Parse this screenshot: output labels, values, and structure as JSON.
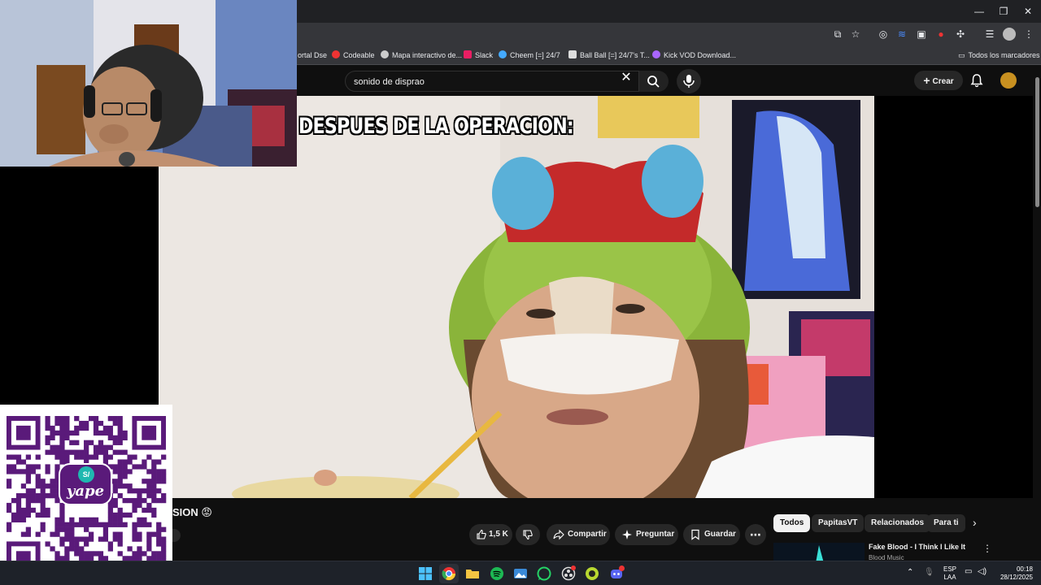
{
  "browser": {
    "bookmarks": [
      {
        "label": "ortal Dse",
        "color": "#3a5"
      },
      {
        "label": "Codeable",
        "color": "#e33"
      },
      {
        "label": "Mapa interactivo de...",
        "color": "#ddd"
      },
      {
        "label": "Slack",
        "color": "#e91e63"
      },
      {
        "label": "Cheem [=] 24/7",
        "color": "#4af"
      },
      {
        "label": "Ball Ball [=] 24/7's T...",
        "color": "#ddd"
      },
      {
        "label": "Kick VOD Download...",
        "color": "#a6f"
      }
    ],
    "all_bookmarks_label": "Todos los marcadores"
  },
  "youtube": {
    "search_value": "sonido de disprao",
    "create_label": "Crear",
    "video_caption": "DESPUES DE LA OPERACION:",
    "video_title_fragment": "SION 😡",
    "actions": {
      "like_count": "1,5 K",
      "share_label": "Compartir",
      "ask_label": "Preguntar",
      "save_label": "Guardar"
    },
    "chips": [
      "Todos",
      "PapitasVT",
      "Relacionados",
      "Para ti"
    ],
    "suggested": {
      "title": "Fake Blood - I Think I Like It",
      "channel": "Blood Music"
    }
  },
  "overlay": {
    "qr_brand": "yape"
  },
  "taskbar": {
    "language_line1": "ESP",
    "language_line2": "LAA",
    "time": "00:18",
    "date": "28/12/2025"
  },
  "colors": {
    "chrome_dark": "#202124",
    "yt_bg": "#0f0f0f",
    "yape_purple": "#5a1a7a",
    "yape_teal": "#1fb8b0"
  }
}
